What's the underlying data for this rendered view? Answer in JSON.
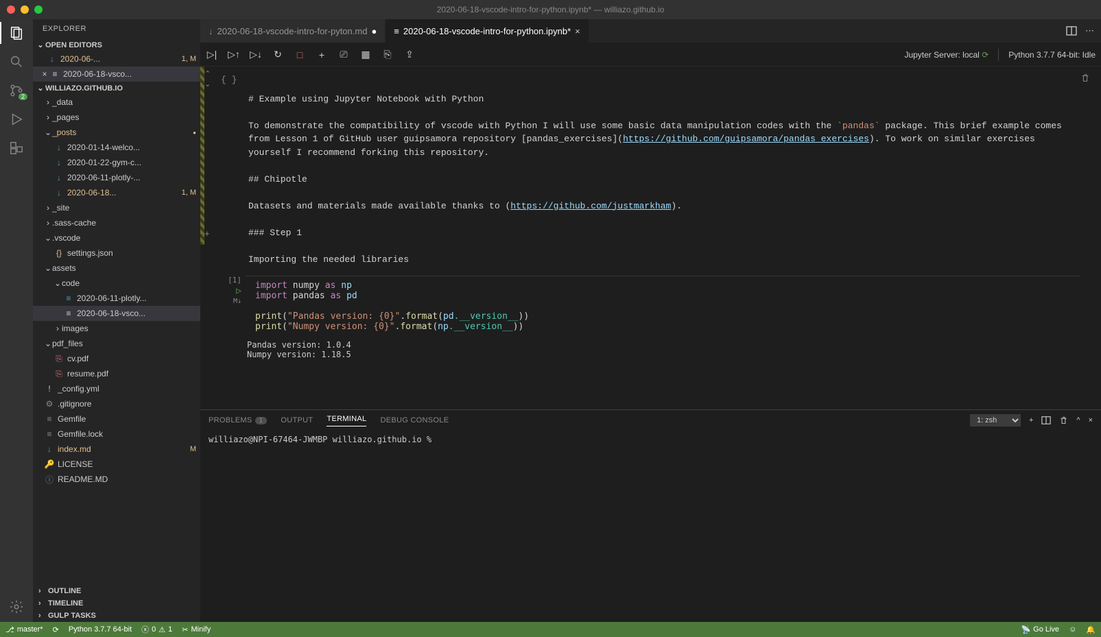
{
  "titlebar": {
    "title": "2020-06-18-vscode-intro-for-python.ipynb* — williazo.github.io"
  },
  "activity": {
    "scm_badge": "2"
  },
  "sidebar": {
    "title": "EXPLORER",
    "open_editors": "OPEN EDITORS",
    "open_items": [
      {
        "label": "2020-06-...",
        "badge": "1, M",
        "modified": true
      },
      {
        "label": "2020-06-18-vsco...",
        "badge": "",
        "close": true,
        "selected": true
      }
    ],
    "project": "WILLIAZO.GITHUB.IO",
    "tree": [
      {
        "type": "folder",
        "open": false,
        "depth": 0,
        "label": "_data"
      },
      {
        "type": "folder",
        "open": false,
        "depth": 0,
        "label": "_pages"
      },
      {
        "type": "folder",
        "open": true,
        "depth": 0,
        "label": "_posts",
        "modified": true,
        "dot": true
      },
      {
        "type": "file",
        "depth": 1,
        "label": "2020-01-14-welco...",
        "icon": "↓",
        "iconcolor": "#519aba"
      },
      {
        "type": "file",
        "depth": 1,
        "label": "2020-01-22-gym-c...",
        "icon": "↓",
        "iconcolor": "#519aba"
      },
      {
        "type": "file",
        "depth": 1,
        "label": "2020-06-11-plotly-...",
        "icon": "↓",
        "iconcolor": "#519aba"
      },
      {
        "type": "file",
        "depth": 1,
        "label": "2020-06-18...",
        "icon": "↓",
        "iconcolor": "#519aba",
        "modified": true,
        "badge": "1, M"
      },
      {
        "type": "folder",
        "open": false,
        "depth": 0,
        "label": "_site"
      },
      {
        "type": "folder",
        "open": false,
        "depth": 0,
        "label": ".sass-cache"
      },
      {
        "type": "folder",
        "open": true,
        "depth": 0,
        "label": ".vscode"
      },
      {
        "type": "file",
        "depth": 1,
        "label": "settings.json",
        "icon": "{}",
        "iconcolor": "#e2c08d"
      },
      {
        "type": "folder",
        "open": true,
        "depth": 0,
        "label": "assets"
      },
      {
        "type": "folder",
        "open": true,
        "depth": 1,
        "label": "code"
      },
      {
        "type": "file",
        "depth": 2,
        "label": "2020-06-11-plotly...",
        "icon": "≡",
        "iconcolor": "#519aba"
      },
      {
        "type": "file",
        "depth": 2,
        "label": "2020-06-18-vsco...",
        "icon": "≡",
        "iconcolor": "#cccccc",
        "selected": true
      },
      {
        "type": "folder",
        "open": false,
        "depth": 1,
        "label": "images"
      },
      {
        "type": "folder",
        "open": true,
        "depth": 0,
        "label": "pdf_files"
      },
      {
        "type": "file",
        "depth": 1,
        "label": "cv.pdf",
        "icon": "⎘",
        "iconcolor": "#e06c75"
      },
      {
        "type": "file",
        "depth": 1,
        "label": "resume.pdf",
        "icon": "⎘",
        "iconcolor": "#e06c75"
      },
      {
        "type": "file",
        "depth": 0,
        "label": "_config.yml",
        "icon": "!",
        "iconcolor": "#e2c08d"
      },
      {
        "type": "file",
        "depth": 0,
        "label": ".gitignore",
        "icon": "⚙",
        "iconcolor": "#888"
      },
      {
        "type": "file",
        "depth": 0,
        "label": "Gemfile",
        "icon": "≡",
        "iconcolor": "#888"
      },
      {
        "type": "file",
        "depth": 0,
        "label": "Gemfile.lock",
        "icon": "≡",
        "iconcolor": "#888"
      },
      {
        "type": "file",
        "depth": 0,
        "label": "index.md",
        "icon": "↓",
        "iconcolor": "#519aba",
        "modified": true,
        "badge": "M"
      },
      {
        "type": "file",
        "depth": 0,
        "label": "LICENSE",
        "icon": "🔑",
        "iconcolor": "#e2c08d"
      },
      {
        "type": "file",
        "depth": 0,
        "label": "README.MD",
        "icon": "ⓘ",
        "iconcolor": "#519aba"
      }
    ],
    "outline": "OUTLINE",
    "timeline": "TIMELINE",
    "gulp": "GULP TASKS"
  },
  "tabs": [
    {
      "label": "2020-06-18-vscode-intro-for-pyton.md",
      "icon": "↓",
      "modified": true
    },
    {
      "label": "2020-06-18-vscode-intro-for-python.ipynb*",
      "icon": "≡",
      "active": true,
      "close": true
    }
  ],
  "toolbar": {
    "jupyter": "Jupyter Server: local",
    "python": "Python 3.7.7 64-bit: Idle"
  },
  "markdown_cell": {
    "header_glyph": "{ }",
    "h1": "# Example using Jupyter Notebook with Python",
    "p1a": "To demonstrate the compatibility of vscode with Python I will use some basic data manipulation codes with the ",
    "p1code": "`pandas`",
    "p1b": " package. This brief example comes from Lesson 1 of GitHub user guipsamora repository [pandas_exercises](",
    "link1": "https://github.com/guipsamora/pandas_exercises",
    "p1c": "). To work on similar exercises yourself I recommend forking this repository.",
    "h2": "## Chipotle",
    "p2a": "Datasets and materials made available thanks to (",
    "link2": "https://github.com/justmarkham",
    "p2b": ").",
    "h3": "### Step 1",
    "p3": "Importing the needed libraries"
  },
  "code_cell": {
    "exec": "[1]",
    "md_label": "M↓",
    "line1": {
      "kw": "import",
      "mod": " numpy ",
      "as": "as",
      "alias": " np"
    },
    "line2": {
      "kw": "import",
      "mod": " pandas ",
      "as": "as",
      "alias": " pd"
    },
    "line3": {
      "fn": "print",
      "open": "(",
      "str": "\"Pandas version: {0}\"",
      "dot": ".",
      "fmt": "format",
      "open2": "(",
      "var": "pd",
      "dunder": ".__version__",
      "close": "))"
    },
    "line4": {
      "fn": "print",
      "open": "(",
      "str": "\"Numpy version: {0}\"",
      "dot": ".",
      "fmt": "format",
      "open2": "(",
      "var": "np",
      "dunder": ".__version__",
      "close": "))"
    }
  },
  "output": {
    "l1": "Pandas version: 1.0.4",
    "l2": "Numpy version: 1.18.5"
  },
  "panel": {
    "problems": "PROBLEMS",
    "problems_count": "1",
    "output": "OUTPUT",
    "terminal": "TERMINAL",
    "debug": "DEBUG CONSOLE",
    "select": "1: zsh",
    "prompt": "williazo@NPI-67464-JWMBP williazo.github.io %"
  },
  "statusbar": {
    "branch": "master*",
    "python": "Python 3.7.7 64-bit",
    "errors": "0",
    "warnings": "1",
    "minify": "Minify",
    "golive": "Go Live"
  }
}
